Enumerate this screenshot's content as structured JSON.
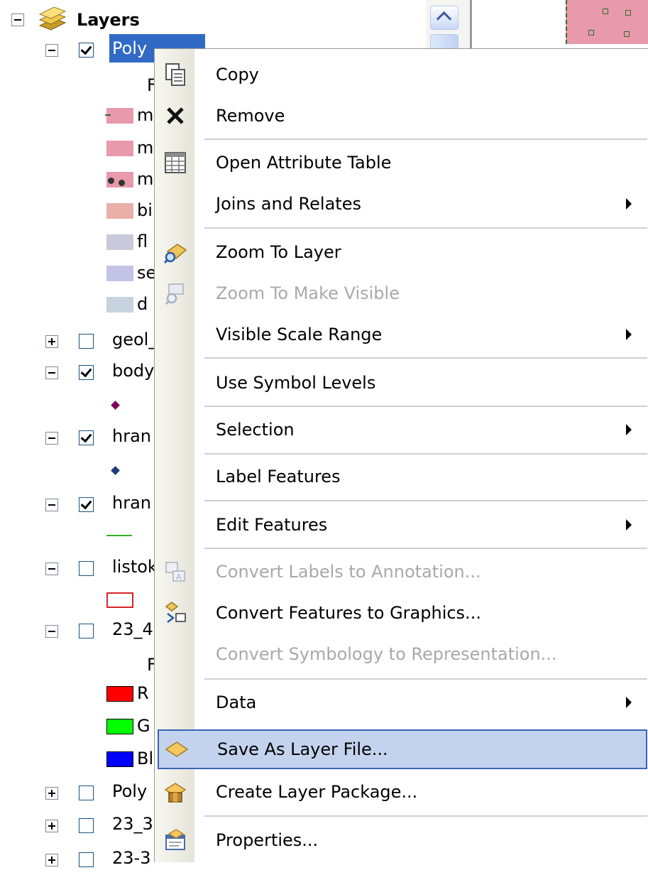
{
  "toc": {
    "root": {
      "label": "Layers"
    },
    "items": [
      {
        "label": "Poly",
        "checked": true,
        "expanded": true
      },
      {
        "label": "F"
      },
      {
        "label": "m"
      },
      {
        "label": "m"
      },
      {
        "label": "m"
      },
      {
        "label": "bi"
      },
      {
        "label": "fl"
      },
      {
        "label": "se"
      },
      {
        "label": "d"
      },
      {
        "label": "geol_",
        "checked": false,
        "expanded": false
      },
      {
        "label": "body",
        "checked": true,
        "expanded": true
      },
      {
        "label": "hran",
        "checked": true,
        "expanded": true
      },
      {
        "label": "hran",
        "checked": true,
        "expanded": true
      },
      {
        "label": "listok",
        "checked": false,
        "expanded": true
      },
      {
        "label": "23_4",
        "checked": false,
        "expanded": true
      },
      {
        "label": "F"
      },
      {
        "label": "R"
      },
      {
        "label": "G"
      },
      {
        "label": "Bl"
      },
      {
        "label": "Poly",
        "checked": false,
        "expanded": false
      },
      {
        "label": "23_3",
        "checked": false,
        "expanded": false
      },
      {
        "label": "23-3",
        "checked": false,
        "expanded": false
      }
    ],
    "colors": {
      "selection": "#316ac5",
      "pink": "#e899ab",
      "salmon": "#e8b0a8",
      "lavender": "#c9c9dc",
      "periwinkle": "#c3c3e8",
      "bluegray": "#c7d3df",
      "purple_marker": "#800060",
      "blue_marker": "#1f3d7a",
      "green_line": "#36b12c",
      "red_outline": "#d4242b",
      "red": "#ff0000",
      "green": "#00ff00",
      "blue": "#0000ff"
    }
  },
  "menu": {
    "items": [
      {
        "label": "Copy",
        "icon": "copy-icon"
      },
      {
        "label": "Remove",
        "icon": "remove-icon"
      },
      {
        "label": "Open Attribute Table",
        "icon": "table-icon"
      },
      {
        "label": "Joins and Relates",
        "submenu": true
      },
      {
        "label": "Zoom To Layer",
        "icon": "zoom-to-layer-icon"
      },
      {
        "label": "Zoom To Make Visible",
        "icon": "zoom-visible-icon",
        "disabled": true
      },
      {
        "label": "Visible Scale Range",
        "submenu": true
      },
      {
        "label": "Use Symbol Levels"
      },
      {
        "label": "Selection",
        "submenu": true
      },
      {
        "label": "Label Features"
      },
      {
        "label": "Edit Features",
        "submenu": true
      },
      {
        "label": "Convert Labels to Annotation...",
        "icon": "convert-labels-icon",
        "disabled": true
      },
      {
        "label": "Convert Features to Graphics...",
        "icon": "convert-features-icon"
      },
      {
        "label": "Convert Symbology to Representation...",
        "disabled": true
      },
      {
        "label": "Data",
        "submenu": true
      },
      {
        "label": "Save As Layer File...",
        "icon": "layer-file-icon",
        "highlighted": true
      },
      {
        "label": "Create Layer Package...",
        "icon": "layer-package-icon"
      },
      {
        "label": "Properties...",
        "icon": "properties-icon"
      }
    ]
  }
}
